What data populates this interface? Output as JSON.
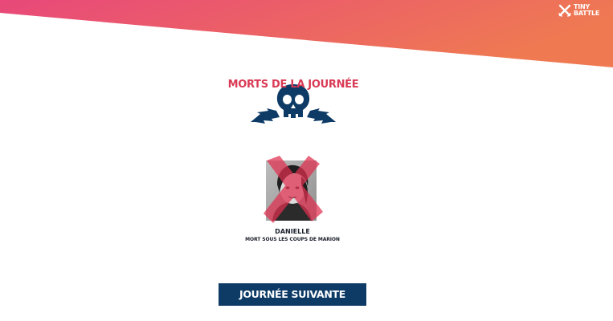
{
  "logo": {
    "line1": "TINY",
    "line2": "BATTLE",
    "icon": "crossed-swords-icon"
  },
  "colors": {
    "banner_gradient_start": "#e8487a",
    "banner_gradient_end": "#ef7a52",
    "title_color": "#d93a55",
    "emblem_color": "#0d3b66",
    "cross_color": "#e0304f",
    "button_background": "#0d3b66",
    "button_text": "#ffffff"
  },
  "heading": {
    "title": "MORTS DE LA JOURNÉE",
    "emblem_icon": "winged-skull-icon"
  },
  "victim": {
    "name": "DANIELLE",
    "cause": "MORT SOUS LES COUPS DE MARION",
    "status_icon": "dead-cross-icon"
  },
  "actions": {
    "next_day_label": "JOURNÉE SUIVANTE"
  }
}
